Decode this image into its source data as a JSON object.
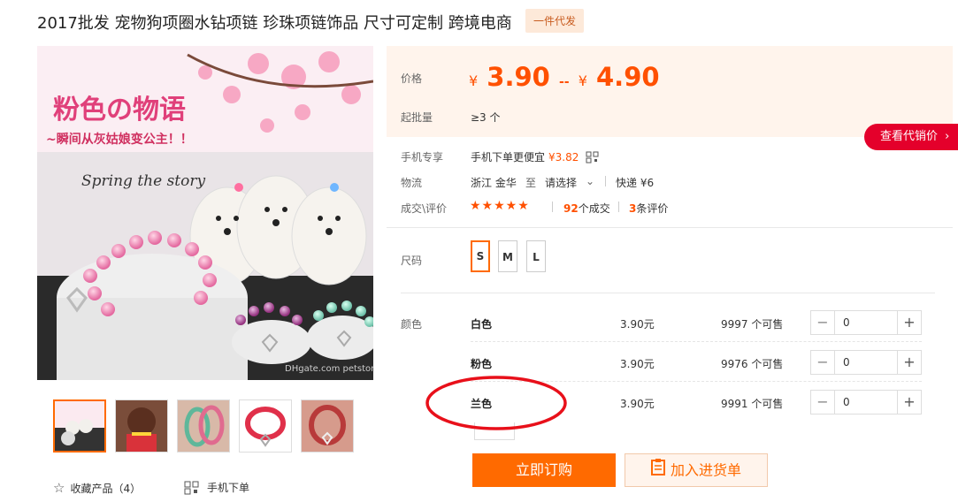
{
  "title": "2017批发 宠物狗项圈水钻项链 珍珠项链饰品 尺寸可定制 跨境电商",
  "badge": "一件代发",
  "image": {
    "headline": "粉色の物语",
    "subheadline": "~瞬间从灰姑娘变公主！！",
    "script_text": "Spring the story",
    "watermark": "DHgate.com petstore"
  },
  "price": {
    "label": "价格",
    "currency": "¥",
    "low": "3.90",
    "sep": "--",
    "high": "4.90"
  },
  "moq": {
    "label": "起批量",
    "value": "≥3 个"
  },
  "dist_button": "查看代销价",
  "mobile": {
    "label": "手机专享",
    "text": "手机下单更便宜",
    "price": "¥3.82"
  },
  "logistics": {
    "label": "物流",
    "origin": "浙江 金华",
    "to": "至",
    "dest": "请选择",
    "method": "快递 ¥6"
  },
  "deals": {
    "label": "成交\\评价",
    "stars": "★★★★★",
    "sold_count": "92",
    "sold_suffix": "个成交",
    "review_count": "3",
    "review_suffix": "条评价"
  },
  "size": {
    "label": "尺码",
    "options": [
      "S",
      "M",
      "L"
    ],
    "selected": "S"
  },
  "color": {
    "label": "颜色",
    "rows": [
      {
        "name": "白色",
        "price": "3.90元",
        "stock": "9997 个可售",
        "qty": "0"
      },
      {
        "name": "粉色",
        "price": "3.90元",
        "stock": "9976 个可售",
        "qty": "0"
      },
      {
        "name": "兰色",
        "price": "3.90元",
        "stock": "9991 个可售",
        "qty": "0"
      }
    ]
  },
  "buttons": {
    "buy": "立即订购",
    "cart": "加入进货单"
  },
  "footer": {
    "favorite": "收藏产品（4）",
    "mobile_order": "手机下单"
  },
  "colors": {
    "accent": "#ff6a00",
    "price": "#ff5000",
    "red_button": "#e4002b",
    "annotation": "#e8101a"
  }
}
